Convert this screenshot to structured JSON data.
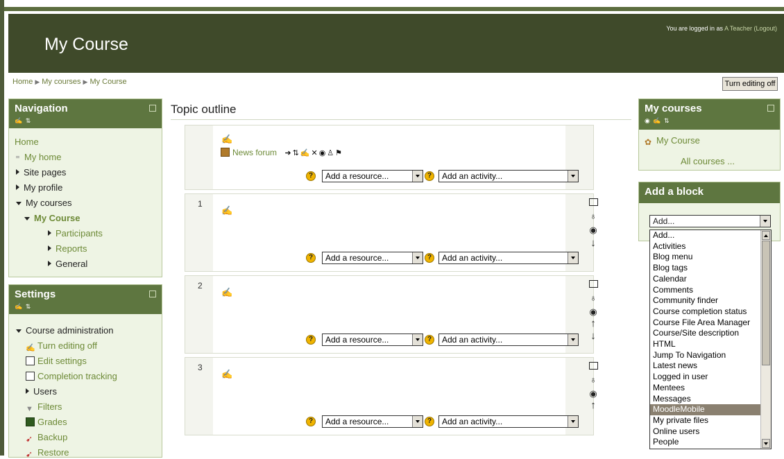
{
  "header": {
    "course_title": "My Course",
    "login_prefix": "You are logged in as ",
    "login_user": "A Teacher",
    "logout": "(Logout)"
  },
  "breadcrumb": [
    "Home",
    "My courses",
    "My Course"
  ],
  "turn_editing_button": "Turn editing off",
  "navigation": {
    "title": "Navigation",
    "home": "Home",
    "my_home": "My home",
    "site_pages": "Site pages",
    "my_profile": "My profile",
    "my_courses": "My courses",
    "my_course": "My Course",
    "participants": "Participants",
    "reports": "Reports",
    "general": "General"
  },
  "settings": {
    "title": "Settings",
    "course_admin": "Course administration",
    "turn_editing_off": "Turn editing off",
    "edit_settings": "Edit settings",
    "completion_tracking": "Completion tracking",
    "users": "Users",
    "filters": "Filters",
    "grades": "Grades",
    "backup": "Backup",
    "restore": "Restore"
  },
  "main": {
    "title": "Topic outline",
    "news_forum": "News forum",
    "add_resource": "Add a resource...",
    "add_activity": "Add an activity...",
    "sections": [
      "1",
      "2",
      "3"
    ]
  },
  "my_courses_block": {
    "title": "My courses",
    "course": "My Course",
    "all_courses": "All courses ..."
  },
  "add_block": {
    "title": "Add a block",
    "selected": "Add...",
    "options": [
      "Add...",
      "Activities",
      "Blog menu",
      "Blog tags",
      "Calendar",
      "Comments",
      "Community finder",
      "Course completion status",
      "Course File Area Manager",
      "Course/Site description",
      "HTML",
      "Jump To Navigation",
      "Latest news",
      "Logged in user",
      "Mentees",
      "Messages",
      "MoodleMobile",
      "My private files",
      "Online users",
      "People"
    ],
    "highlighted": "MoodleMobile"
  },
  "colors": {
    "header": "#3f4a2a",
    "block_header": "#5e7640",
    "block_body": "#eef4e4",
    "link": "#6d8a37"
  }
}
